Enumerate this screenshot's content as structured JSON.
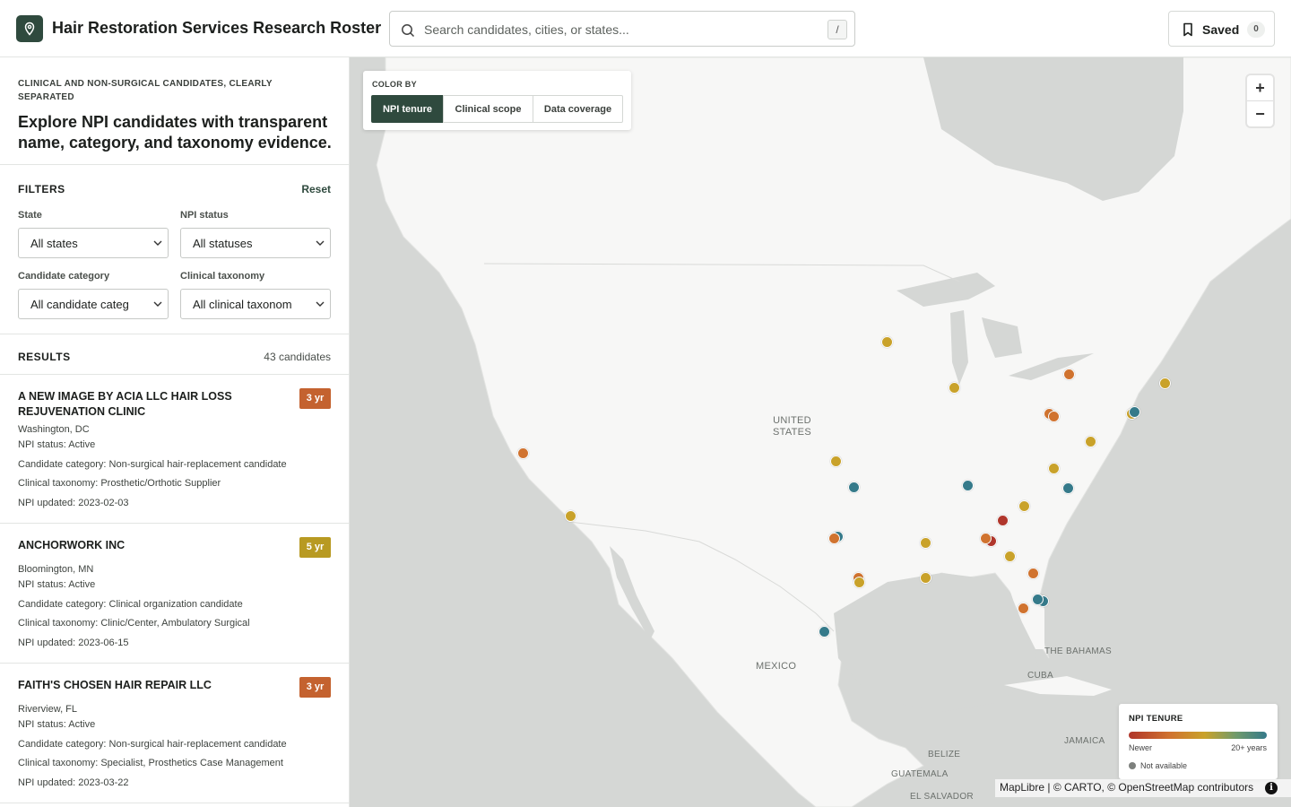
{
  "header": {
    "title": "Hair Restoration Services Research Roster",
    "search_placeholder": "Search candidates, cities, or states...",
    "search_shortcut": "/",
    "saved_label": "Saved",
    "saved_count": "0"
  },
  "intro": {
    "eyebrow": "CLINICAL AND NON-SURGICAL CANDIDATES, CLEARLY SEPARATED",
    "headline": "Explore NPI candidates with transparent name, category, and taxonomy evidence."
  },
  "filters": {
    "title": "FILTERS",
    "reset_label": "Reset",
    "state": {
      "label": "State",
      "value": "All states"
    },
    "npi_status": {
      "label": "NPI status",
      "value": "All statuses"
    },
    "candidate_category": {
      "label": "Candidate category",
      "value": "All candidate categ"
    },
    "clinical_taxonomy": {
      "label": "Clinical taxonomy",
      "value": "All clinical taxonom"
    }
  },
  "results": {
    "title": "RESULTS",
    "count": "43 candidates",
    "items": [
      {
        "name": "A NEW IMAGE BY ACIA LLC HAIR LOSS REJUVENATION CLINIC",
        "badge": "3 yr",
        "badge_color": "#c4622f",
        "location": "Washington, DC",
        "status": "NPI status: Active",
        "category": "Candidate category: Non-surgical hair-replacement candidate",
        "taxonomy": "Clinical taxonomy: Prosthetic/Orthotic Supplier",
        "updated": "NPI updated: 2023-02-03"
      },
      {
        "name": "ANCHORWORK INC",
        "badge": "5 yr",
        "badge_color": "#b89a22",
        "location": "Bloomington, MN",
        "status": "NPI status: Active",
        "category": "Candidate category: Clinical organization candidate",
        "taxonomy": "Clinical taxonomy: Clinic/Center, Ambulatory Surgical",
        "updated": "NPI updated: 2023-06-15"
      },
      {
        "name": "FAITH'S CHOSEN HAIR REPAIR LLC",
        "badge": "3 yr",
        "badge_color": "#c4622f",
        "location": "Riverview, FL",
        "status": "NPI status: Active",
        "category": "Candidate category: Non-surgical hair-replacement candidate",
        "taxonomy": "Clinical taxonomy: Specialist, Prosthetics Case Management",
        "updated": "NPI updated: 2023-03-22"
      }
    ]
  },
  "map": {
    "color_by_label": "COLOR BY",
    "color_by_options": [
      "NPI tenure",
      "Clinical scope",
      "Data coverage"
    ],
    "color_by_selected": "NPI tenure",
    "zoom_in": "+",
    "zoom_out": "−",
    "labels": {
      "us": "UNITED\nSTATES",
      "mexico": "MEXICO",
      "bahamas": "THE BAHAMAS",
      "cuba": "CUBA",
      "jamaica": "JAMAICA",
      "belize": "BELIZE",
      "guatemala": "GUATEMALA",
      "el_salvador": "EL SALVADOR"
    },
    "legend": {
      "title": "NPI TENURE",
      "min_label": "Newer",
      "max_label": "20+ years",
      "na_label": "Not available"
    },
    "attribution": "MapLibre | © CARTO, © OpenStreetMap contributors",
    "colors": {
      "newest": "#b0362b",
      "new": "#d0732f",
      "mid": "#c9a22a",
      "old": "#357a8a"
    }
  }
}
